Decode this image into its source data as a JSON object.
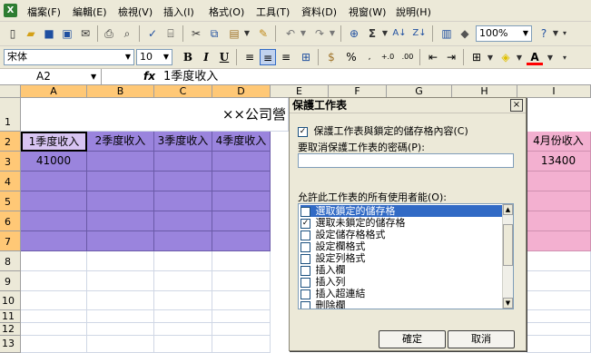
{
  "menu": {
    "items": [
      "檔案(F)",
      "編輯(E)",
      "檢視(V)",
      "插入(I)",
      "格式(O)",
      "工具(T)",
      "資料(D)",
      "視窗(W)",
      "說明(H)"
    ]
  },
  "toolbar": {
    "zoom": "100%",
    "sigma": "Σ"
  },
  "format_toolbar": {
    "font_name": "宋体",
    "font_size": "10",
    "bold": "B",
    "italic": "I",
    "underline": "U",
    "percent": "%"
  },
  "formula_bar": {
    "name_box": "A2",
    "fx": "fx",
    "content": "1季度收入"
  },
  "sheet": {
    "columns": [
      "A",
      "B",
      "C",
      "D",
      "E",
      "F",
      "G",
      "H",
      "I"
    ],
    "rows": [
      "1",
      "2",
      "3",
      "4",
      "5",
      "6",
      "7",
      "8",
      "9",
      "10",
      "11",
      "12",
      "13"
    ],
    "title_partial": "××公司營",
    "headers": [
      "1季度收入",
      "2季度收入",
      "3季度收入",
      "4季度收入"
    ],
    "i2": "4月份收入",
    "a3": "41000",
    "i3": "13400"
  },
  "dialog": {
    "title": "保護工作表",
    "close": "×",
    "protect_label": "保護工作表與鎖定的儲存格內容(C)",
    "password_label": "要取消保護工作表的密碼(P):",
    "allow_label": "允許此工作表的所有使用者能(O):",
    "permissions": [
      {
        "label": "選取鎖定的儲存格",
        "checked": true,
        "selected": true
      },
      {
        "label": "選取未鎖定的儲存格",
        "checked": true,
        "selected": false
      },
      {
        "label": "設定儲存格格式",
        "checked": false,
        "selected": false
      },
      {
        "label": "設定欄格式",
        "checked": false,
        "selected": false
      },
      {
        "label": "設定列格式",
        "checked": false,
        "selected": false
      },
      {
        "label": "插入欄",
        "checked": false,
        "selected": false
      },
      {
        "label": "插入列",
        "checked": false,
        "selected": false
      },
      {
        "label": "插入超連結",
        "checked": false,
        "selected": false
      },
      {
        "label": "刪除欄",
        "checked": false,
        "selected": false
      }
    ],
    "ok_label": "確定",
    "cancel_label": "取消"
  }
}
